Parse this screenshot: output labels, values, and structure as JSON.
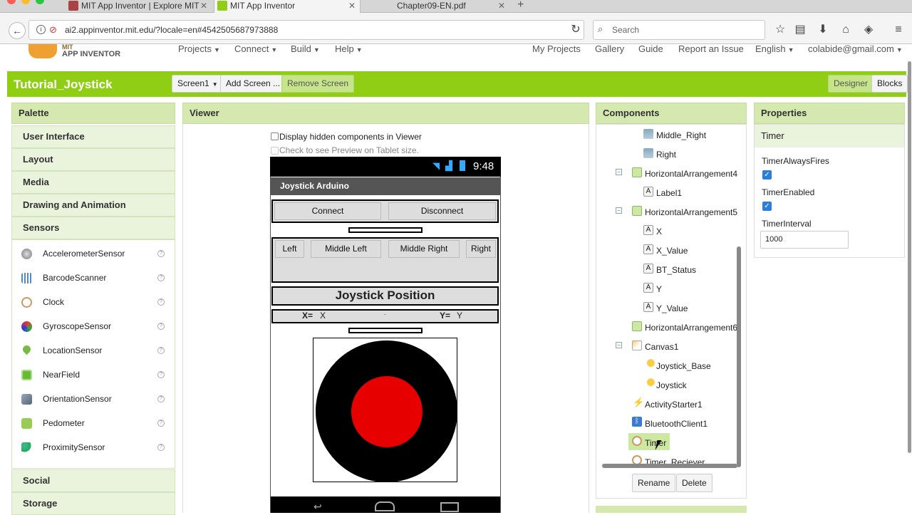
{
  "browser": {
    "tabs": [
      {
        "label": "MIT App Inventor | Explore MIT"
      },
      {
        "label": "MIT App Inventor"
      },
      {
        "label": "Chapter09-EN.pdf"
      }
    ],
    "url": "ai2.appinventor.mit.edu/?locale=en#4542505687973888",
    "search_placeholder": "Search"
  },
  "header": {
    "logo_text": "APP INVENTOR",
    "logo_text_top": "MIT",
    "menus": [
      "Projects",
      "Connect",
      "Build",
      "Help"
    ],
    "right_links": [
      "My Projects",
      "Gallery",
      "Guide",
      "Report an Issue",
      "English",
      "colabide@gmail.com"
    ]
  },
  "project": {
    "title": "Tutorial_Joystick",
    "screen_select": "Screen1",
    "add_screen": "Add Screen ...",
    "remove_screen": "Remove Screen",
    "designer": "Designer",
    "blocks": "Blocks"
  },
  "palette": {
    "title": "Palette",
    "categories_top": [
      "User Interface",
      "Layout",
      "Media",
      "Drawing and Animation",
      "Sensors"
    ],
    "items": [
      {
        "label": "AccelerometerSensor",
        "icon": "accelerometer-icon"
      },
      {
        "label": "BarcodeScanner",
        "icon": "barcode-icon"
      },
      {
        "label": "Clock",
        "icon": "clock-icon"
      },
      {
        "label": "GyroscopeSensor",
        "icon": "gyroscope-icon"
      },
      {
        "label": "LocationSensor",
        "icon": "location-icon"
      },
      {
        "label": "NearField",
        "icon": "nearfield-icon"
      },
      {
        "label": "OrientationSensor",
        "icon": "orientation-icon"
      },
      {
        "label": "Pedometer",
        "icon": "pedometer-icon"
      },
      {
        "label": "ProximitySensor",
        "icon": "proximity-icon"
      }
    ],
    "categories_bottom": [
      "Social",
      "Storage"
    ],
    "help_glyph": "?"
  },
  "viewer": {
    "title": "Viewer",
    "hidden_components_label": "Display hidden components in Viewer",
    "tablet_preview_label": "Check to see Preview on Tablet size.",
    "phone": {
      "time": "9:48",
      "app_title": "Joystick Arduino",
      "connect": "Connect",
      "disconnect": "Disconnect",
      "left": "Left",
      "middle_left": "Middle Left",
      "middle_right": "Middle Right",
      "right": "Right",
      "joystick_position": "Joystick Position",
      "x_label": "X=",
      "x_value": "X",
      "y_label": "Y=",
      "y_value": "Y",
      "dot": "."
    }
  },
  "components": {
    "title": "Components",
    "tree": [
      {
        "label": "Middle_Right",
        "icon": "button-icon"
      },
      {
        "label": "Right",
        "icon": "button-icon"
      },
      {
        "label": "HorizontalArrangement4",
        "icon": "arrangement-icon",
        "toggle": "⊖"
      },
      {
        "label": "Label1",
        "icon": "label-icon"
      },
      {
        "label": "HorizontalArrangement5",
        "icon": "arrangement-icon",
        "toggle": "⊖"
      },
      {
        "label": "X",
        "icon": "label-icon"
      },
      {
        "label": "X_Value",
        "icon": "label-icon"
      },
      {
        "label": "BT_Status",
        "icon": "label-icon"
      },
      {
        "label": "Y",
        "icon": "label-icon"
      },
      {
        "label": "Y_Value",
        "icon": "label-icon"
      },
      {
        "label": "HorizontalArrangement6",
        "icon": "arrangement-icon"
      },
      {
        "label": "Canvas1",
        "icon": "canvas-icon",
        "toggle": "⊖"
      },
      {
        "label": "Joystick_Base",
        "icon": "sprite-icon"
      },
      {
        "label": "Joystick",
        "icon": "sprite-icon"
      },
      {
        "label": "ActivityStarter1",
        "icon": "activity-icon"
      },
      {
        "label": "BluetoothClient1",
        "icon": "bluetooth-icon"
      },
      {
        "label": "Timer",
        "icon": "clock-icon",
        "selected": true
      },
      {
        "label": "Timer_Reciever",
        "icon": "clock-icon"
      }
    ],
    "rename": "Rename",
    "delete": "Delete"
  },
  "properties": {
    "title": "Properties",
    "component": "Timer",
    "always_fires_label": "TimerAlwaysFires",
    "always_fires_checked": true,
    "enabled_label": "TimerEnabled",
    "enabled_checked": true,
    "interval_label": "TimerInterval",
    "interval_value": "1000"
  },
  "colors": {
    "green_bar": "#8fce14",
    "panel_header": "#d4e8b0",
    "joystick_base": "#000000",
    "joystick_knob": "#e60000"
  }
}
